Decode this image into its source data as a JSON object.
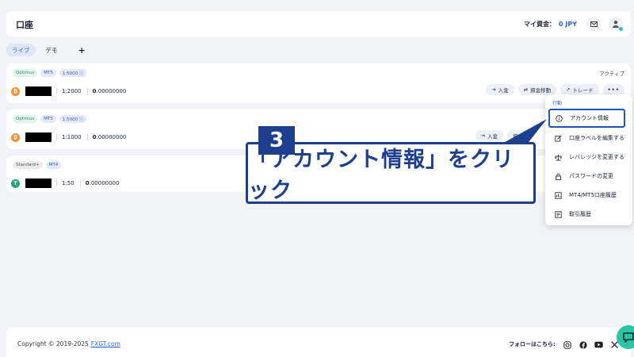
{
  "header": {
    "title": "口座",
    "funds_label": "マイ資金：",
    "funds_value": "0 JPY"
  },
  "tabs": [
    {
      "label": "ライブ"
    },
    {
      "label": "デモ"
    },
    {
      "label": "+"
    }
  ],
  "actions": {
    "deposit": "入金",
    "transfer": "資金移動",
    "trade": "トレード",
    "more": "•••"
  },
  "accounts": [
    {
      "badges": [
        "Optimus",
        "MT5",
        "1:5000 ⓘ"
      ],
      "leverage": "1:2000",
      "balance_int": "0",
      "balance_dec": ".00000000",
      "status": "アクティブ"
    },
    {
      "badges": [
        "Optimus",
        "MT5",
        "1:5000 ⓘ"
      ],
      "leverage": "1:1000",
      "balance_int": "0",
      "balance_dec": ".00000000"
    },
    {
      "badges": [
        "Standard+",
        "MT4"
      ],
      "leverage": "1:50",
      "balance_int": "0",
      "balance_dec": ".00000000"
    }
  ],
  "dropdown": {
    "header": "行動",
    "items": [
      {
        "label": "アカウント情報",
        "icon": "info-icon"
      },
      {
        "label": "口座ラベルを編集する",
        "icon": "edit-icon"
      },
      {
        "label": "レバレッジを変更する",
        "icon": "scale-icon"
      },
      {
        "label": "パスワードの変更",
        "icon": "lock-icon"
      },
      {
        "label": "MT4/MT5口座履歴",
        "icon": "history-icon"
      },
      {
        "label": "取引履歴",
        "icon": "trade-history-icon"
      }
    ]
  },
  "annotation": {
    "step": "3",
    "text": "「アカウント情報」をクリック",
    "color": "#1e3f8e"
  },
  "footer": {
    "copyright": "Copyright © 2019-2025",
    "link": "FXGT.com",
    "follow": "フォローはこちら:"
  },
  "colors": {
    "accent": "#2f5fe8",
    "background": "#f2f3f7",
    "chat": "#2bc4a5"
  }
}
